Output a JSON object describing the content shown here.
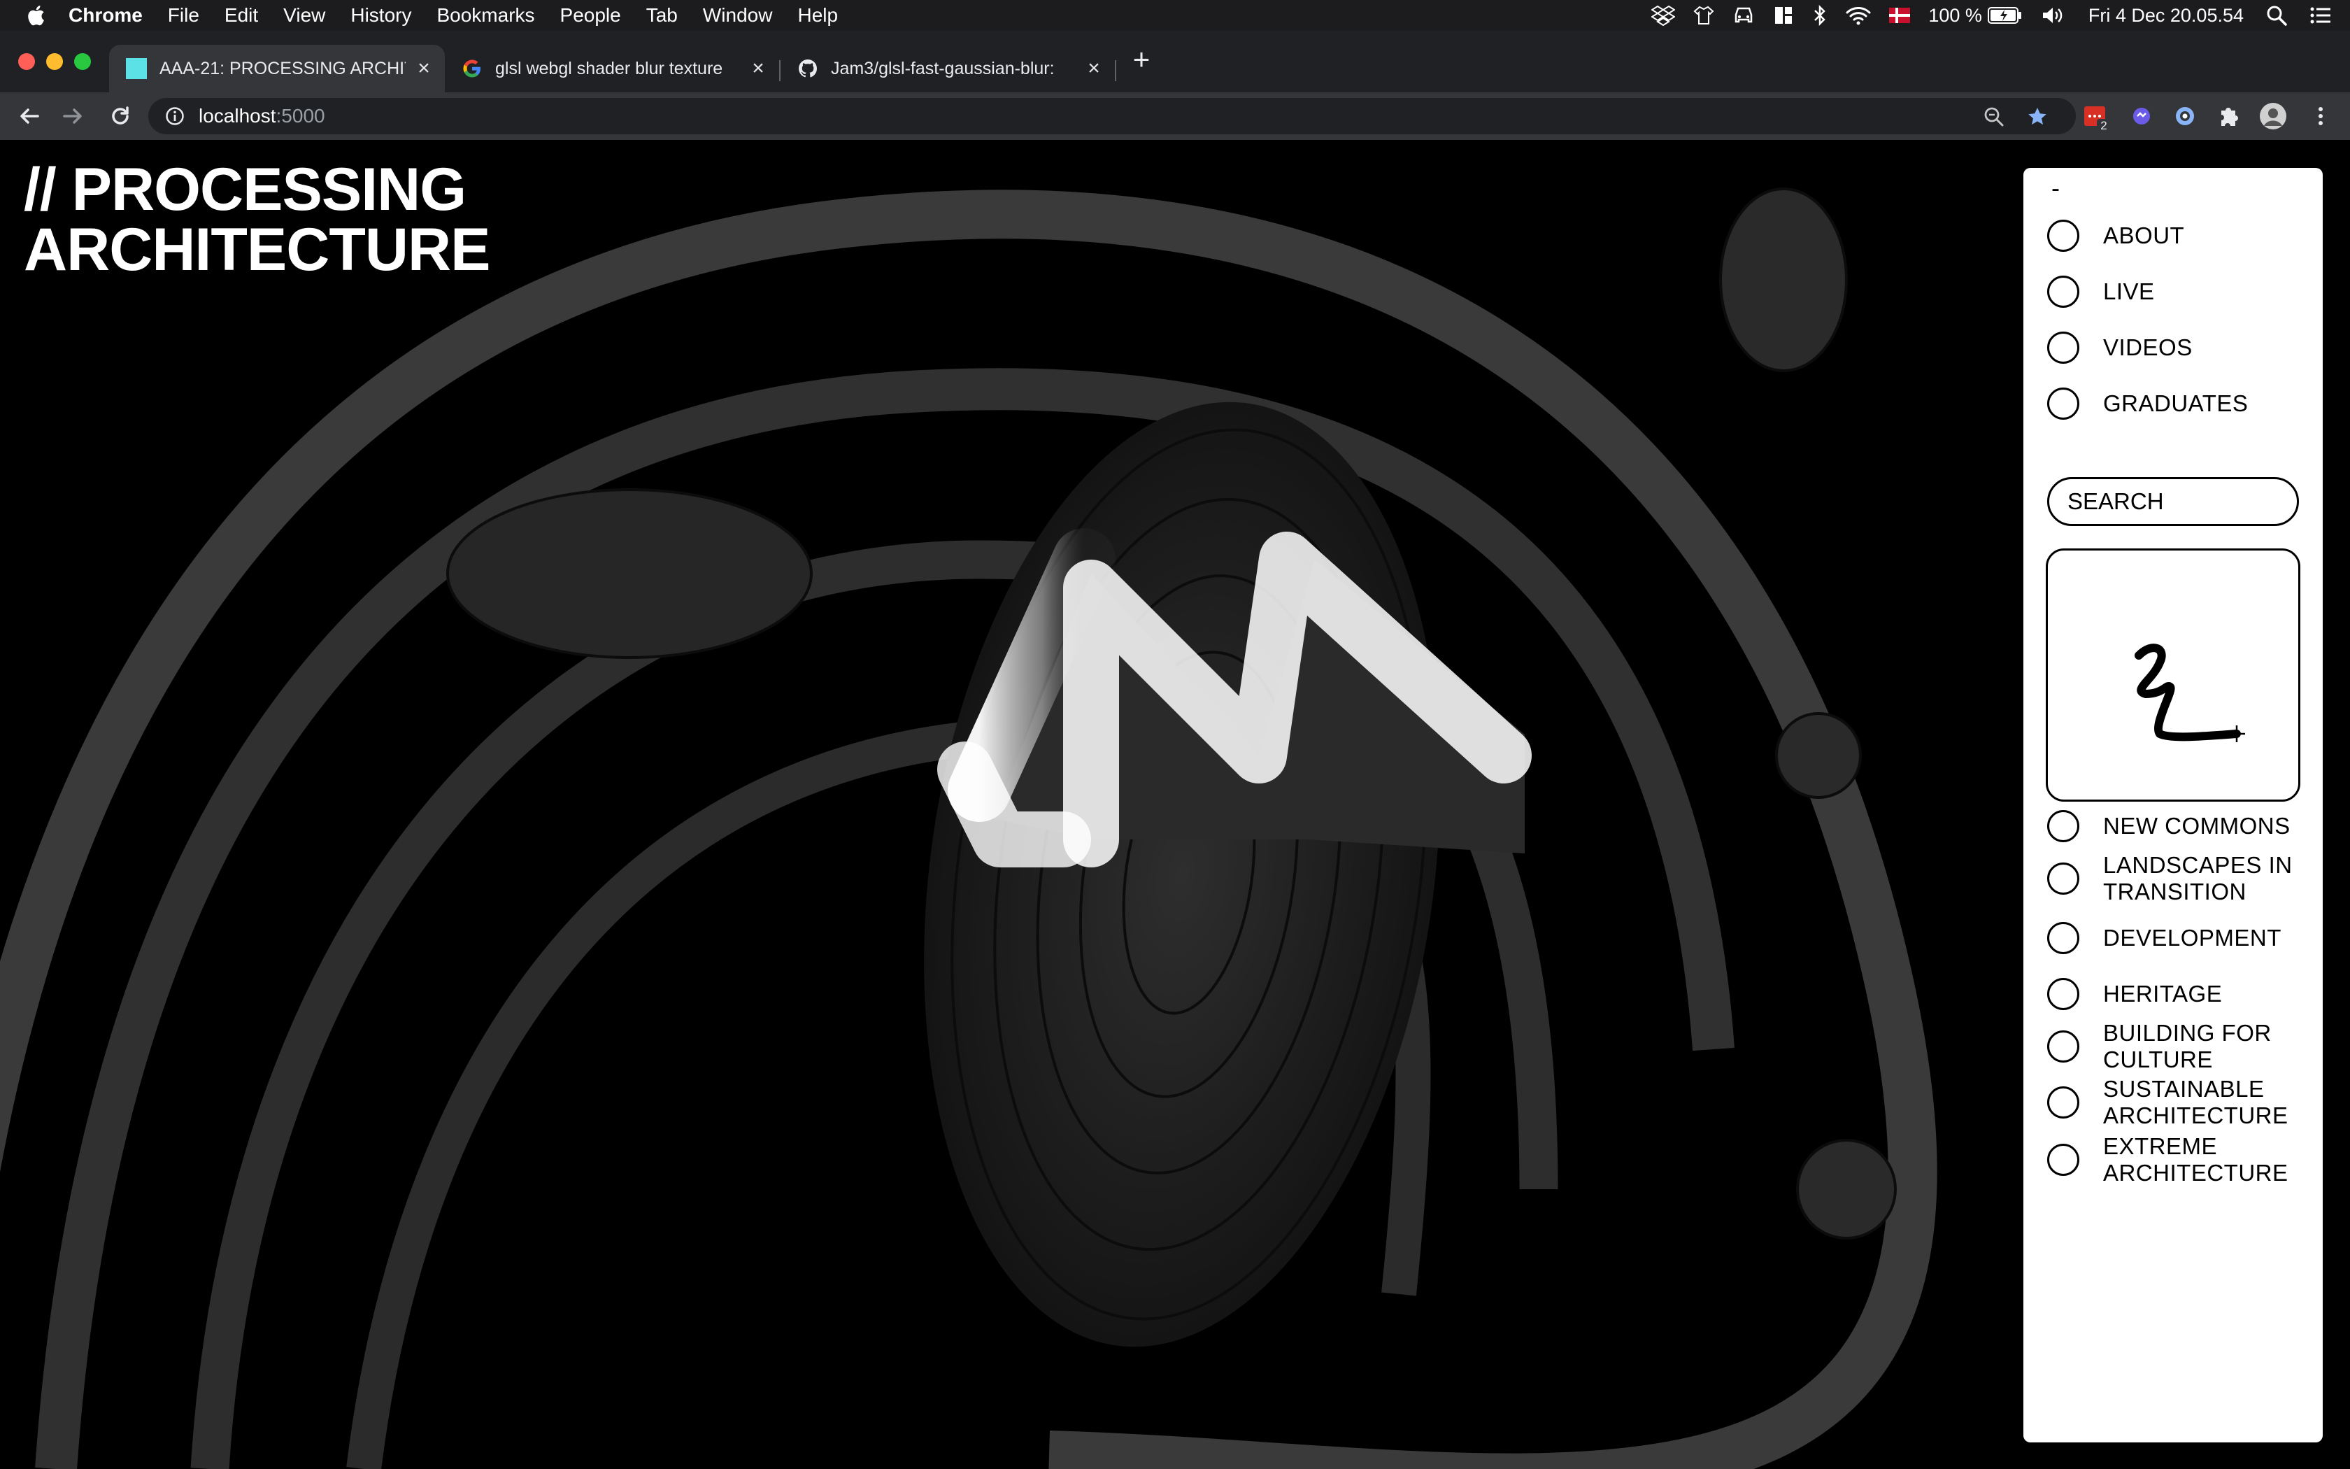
{
  "menubar": {
    "app": "Chrome",
    "items": [
      "File",
      "Edit",
      "View",
      "History",
      "Bookmarks",
      "People",
      "Tab",
      "Window",
      "Help"
    ],
    "battery": "100 %",
    "datetime": "Fri 4 Dec  20.05.54"
  },
  "tabs": [
    {
      "title": "AAA-21: PROCESSING ARCHITE",
      "active": true,
      "favicon_color": "#5ce1e6"
    },
    {
      "title": "glsl webgl shader blur texture",
      "active": false
    },
    {
      "title": "Jam3/glsl-fast-gaussian-blur:",
      "active": false
    }
  ],
  "address": {
    "host": "localhost",
    "port": ":5000"
  },
  "extensions": {
    "badge": "2"
  },
  "site": {
    "title_line1": "// PROCESSING",
    "title_line2": "ARCHITECTURE"
  },
  "panel": {
    "dash": "-",
    "nav": [
      "ABOUT",
      "LIVE",
      "VIDEOS",
      "GRADUATES"
    ],
    "search_placeholder": "SEARCH",
    "categories": [
      "NEW COMMONS",
      "LANDSCAPES IN TRANSITION",
      "DEVELOPMENT",
      "HERITAGE",
      "BUILDING FOR CULTURE",
      "SUSTAINABLE ARCHITECTURE",
      "EXTREME ARCHITECTURE"
    ]
  },
  "colors": {
    "page_bg": "#000000",
    "panel_bg": "#ffffff",
    "tab_bar": "#202124",
    "toolbar": "#35363a",
    "traffic_red": "#ff5f57",
    "traffic_yellow": "#febc2e",
    "traffic_green": "#28c840",
    "bookmark_star": "#8ab4f8"
  }
}
